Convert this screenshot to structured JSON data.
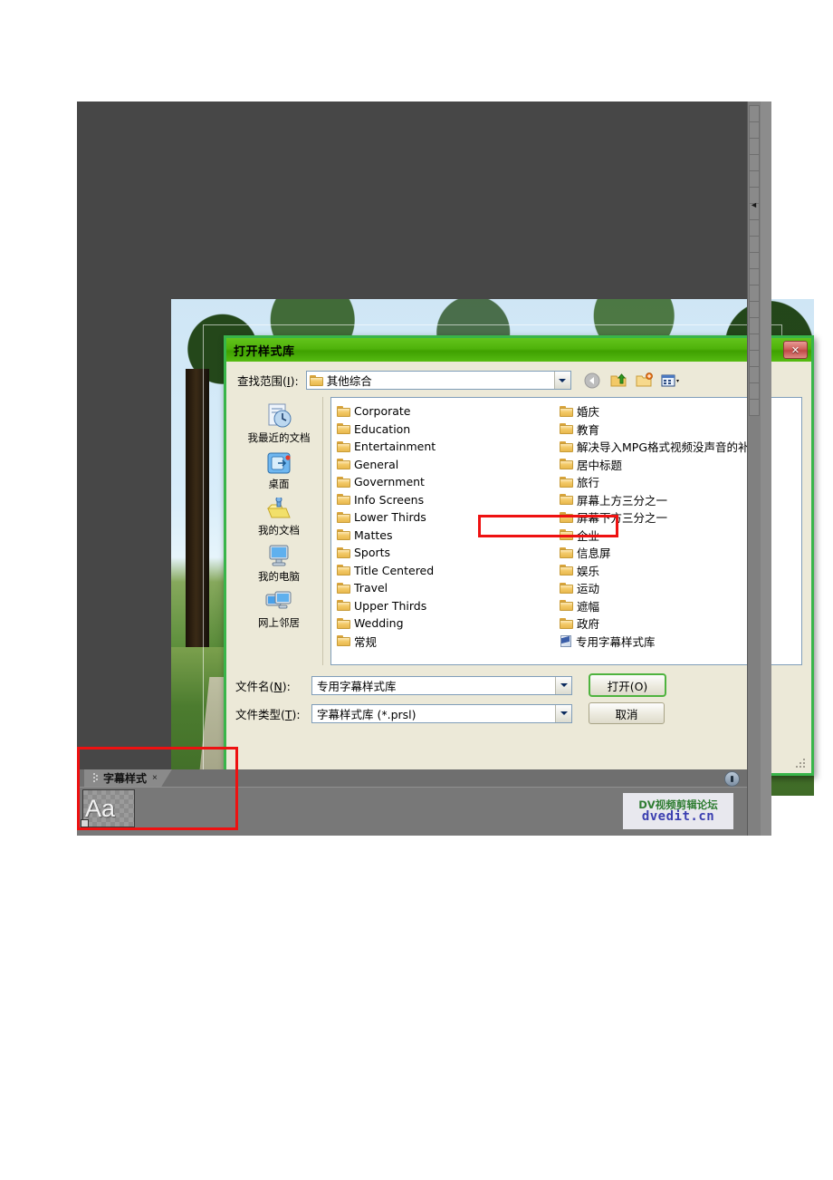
{
  "dialog": {
    "title": "打开样式库",
    "close_label": "✕",
    "lookin": {
      "label_prefix": "查找范围",
      "label_accel": "I",
      "label_suffix": "):",
      "value": "其他综合",
      "icon": "folder-icon"
    },
    "nav_icons": [
      {
        "name": "back-icon",
        "title": "后退"
      },
      {
        "name": "up-folder-icon",
        "title": "向上一级"
      },
      {
        "name": "new-folder-icon",
        "title": "新建文件夹"
      },
      {
        "name": "views-icon",
        "title": "查看"
      }
    ],
    "places": [
      {
        "label": "我最近的文档",
        "icon": "recent-documents-icon"
      },
      {
        "label": "桌面",
        "icon": "desktop-icon"
      },
      {
        "label": "我的文档",
        "icon": "my-documents-icon"
      },
      {
        "label": "我的电脑",
        "icon": "my-computer-icon"
      },
      {
        "label": "网上邻居",
        "icon": "network-places-icon"
      }
    ],
    "files": [
      {
        "name": "Corporate",
        "type": "folder",
        "selected": false
      },
      {
        "name": "Education",
        "type": "folder",
        "selected": false
      },
      {
        "name": "Entertainment",
        "type": "folder",
        "selected": false
      },
      {
        "name": "General",
        "type": "folder",
        "selected": false
      },
      {
        "name": "Government",
        "type": "folder",
        "selected": false
      },
      {
        "name": "Info Screens",
        "type": "folder",
        "selected": false
      },
      {
        "name": "Lower Thirds",
        "type": "folder",
        "selected": false
      },
      {
        "name": "Mattes",
        "type": "folder",
        "selected": false
      },
      {
        "name": "Sports",
        "type": "folder",
        "selected": false
      },
      {
        "name": "Title Centered",
        "type": "folder",
        "selected": false
      },
      {
        "name": "Travel",
        "type": "folder",
        "selected": false
      },
      {
        "name": "Upper Thirds",
        "type": "folder",
        "selected": false
      },
      {
        "name": "Wedding",
        "type": "folder",
        "selected": false
      },
      {
        "name": "常规",
        "type": "folder",
        "selected": false
      },
      {
        "name": "婚庆",
        "type": "folder",
        "selected": false
      },
      {
        "name": "教育",
        "type": "folder",
        "selected": false
      },
      {
        "name": "解决导入MPG格式视频没声音的补丁",
        "type": "folder",
        "selected": false
      },
      {
        "name": "居中标题",
        "type": "folder",
        "selected": false
      },
      {
        "name": "旅行",
        "type": "folder",
        "selected": false
      },
      {
        "name": "屏幕上方三分之一",
        "type": "folder",
        "selected": false
      },
      {
        "name": "屏幕下方三分之一",
        "type": "folder",
        "selected": false
      },
      {
        "name": "企业",
        "type": "folder",
        "selected": false
      },
      {
        "name": "信息屏",
        "type": "folder",
        "selected": false
      },
      {
        "name": "娱乐",
        "type": "folder",
        "selected": false
      },
      {
        "name": "运动",
        "type": "folder",
        "selected": false
      },
      {
        "name": "遮幅",
        "type": "folder",
        "selected": false
      },
      {
        "name": "政府",
        "type": "folder",
        "selected": false
      },
      {
        "name": "专用字幕样式库",
        "type": "file",
        "selected": true
      }
    ],
    "filename_field": {
      "label_prefix": "文件名",
      "label_accel": "N",
      "label_suffix": "):",
      "value": "专用字幕样式库"
    },
    "filetype_field": {
      "label_prefix": "文件类型",
      "label_accel": "T",
      "label_suffix": "):",
      "value": "字幕样式库 (*.prsl)"
    },
    "open_button": "打开(O)",
    "cancel_button": "取消"
  },
  "bottom_panel": {
    "tab_label": "字幕样式",
    "tab_close": "×",
    "style_swatch_text": "Aa"
  },
  "watermark": {
    "line1": "DV视频剪辑论坛",
    "line2": "dvedit.cn"
  },
  "annotations": [
    {
      "name": "highlight-selected-file",
      "target": "专用字幕样式库"
    },
    {
      "name": "highlight-title-style-panel",
      "target": "字幕样式"
    }
  ],
  "colors": {
    "dialog_border_green": "#39b54a",
    "titlebar_green": "#4fb30b",
    "annotation_red": "#ee1111",
    "app_background": "#474747",
    "panel_grey": "#787878",
    "watermark_green": "#2f7d32",
    "watermark_blue": "#3b3fb0"
  }
}
